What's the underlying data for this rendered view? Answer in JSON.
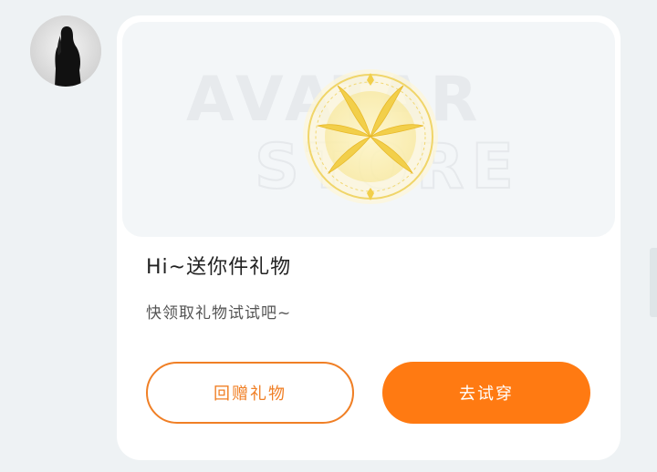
{
  "watermark": {
    "line1": "AVATAR",
    "line2": "STORE"
  },
  "card": {
    "title": "Hi~送你件礼物",
    "subtitle": "快领取礼物试试吧~",
    "return_gift_label": "回赠礼物",
    "try_on_label": "去试穿"
  },
  "colors": {
    "accent": "#ff7a12",
    "outline": "#f07f25",
    "gold": "#f2cf4a"
  }
}
